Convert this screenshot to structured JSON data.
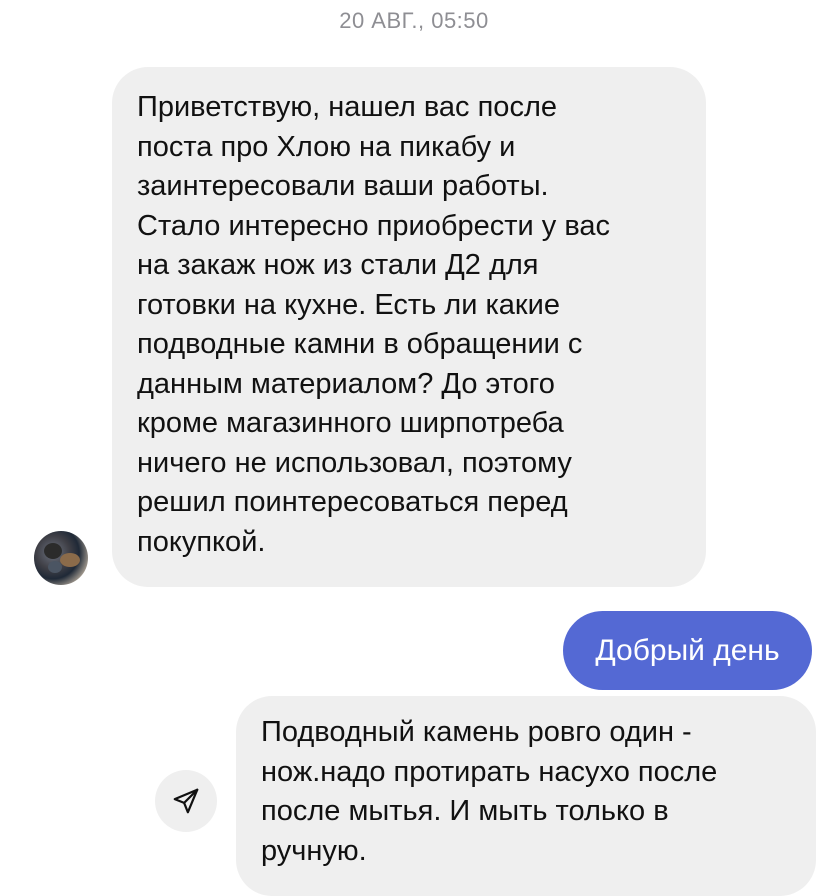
{
  "timestamp": "20 АВГ., 05:50",
  "messages": [
    {
      "direction": "incoming",
      "lines": [
        "Приветствую, нашел вас после",
        "поста про Хлою на пикабу и",
        "заинтересовали ваши работы.",
        "Стало интересно приобрести у вас",
        "на закаж нож из стали Д2 для",
        "готовки на кухне. Есть ли какие",
        "подводные камни в обращении с",
        "данным материалом? До этого",
        "кроме магазинного ширпотреба",
        "ничего не использовал, поэтому",
        "решил поинтересоваться перед",
        "покупкой."
      ]
    },
    {
      "direction": "outgoing",
      "text": "Добрый день",
      "color": "#5469d4"
    },
    {
      "direction": "incoming",
      "lines": [
        "Подводный камень ровго один -",
        "нож.надо протирать насухо после",
        "после мытья. И мыть только в",
        "ручную."
      ]
    }
  ],
  "icons": {
    "avatar": "user-avatar-photo",
    "share": "paper-plane-icon"
  }
}
